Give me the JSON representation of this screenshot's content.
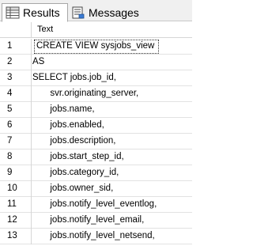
{
  "tabs": [
    {
      "label": "Results",
      "icon": "results-grid-icon",
      "active": true
    },
    {
      "label": "Messages",
      "icon": "messages-icon",
      "active": false
    }
  ],
  "grid": {
    "column_header": "Text",
    "rows": [
      {
        "num": "1",
        "text": "CREATE VIEW sysjobs_view"
      },
      {
        "num": "2",
        "text": "AS"
      },
      {
        "num": "3",
        "text": "SELECT jobs.job_id,"
      },
      {
        "num": "4",
        "text": "       svr.originating_server,"
      },
      {
        "num": "5",
        "text": "       jobs.name,"
      },
      {
        "num": "6",
        "text": "       jobs.enabled,"
      },
      {
        "num": "7",
        "text": "       jobs.description,"
      },
      {
        "num": "8",
        "text": "       jobs.start_step_id,"
      },
      {
        "num": "9",
        "text": "       jobs.category_id,"
      },
      {
        "num": "10",
        "text": "       jobs.owner_sid,"
      },
      {
        "num": "11",
        "text": "       jobs.notify_level_eventlog,"
      },
      {
        "num": "12",
        "text": "       jobs.notify_level_email,"
      },
      {
        "num": "13",
        "text": "       jobs.notify_level_netsend,"
      }
    ]
  }
}
